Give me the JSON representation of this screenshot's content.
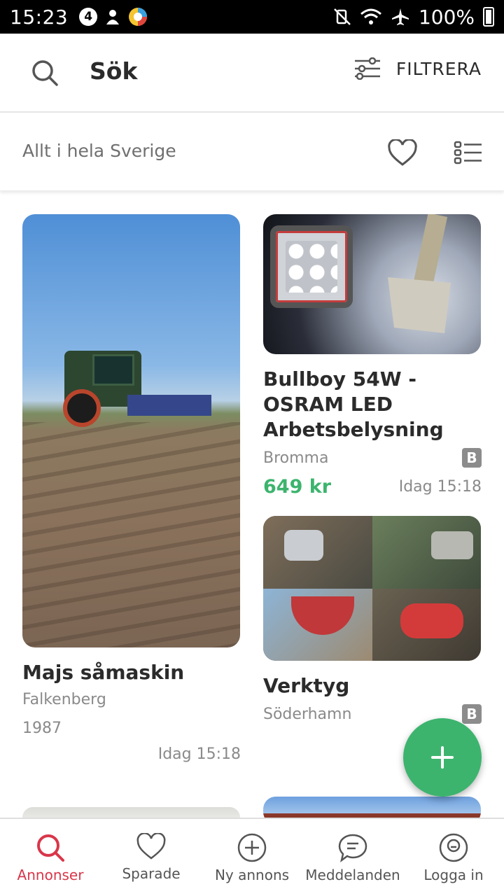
{
  "status_bar": {
    "time": "15:23",
    "notification_badge": "4",
    "battery": "100%"
  },
  "header": {
    "title": "Sök",
    "filter_label": "FILTRERA"
  },
  "subbar": {
    "location": "Allt i hela Sverige"
  },
  "listings": [
    {
      "title": "Majs såmaskin",
      "location": "Falkenberg",
      "extra": "1987",
      "time": "Idag 15:18"
    },
    {
      "title": "Bullboy 54W - OSRAM LED Arbetsbelysning",
      "location": "Bromma",
      "badge": "B",
      "price": "649 kr",
      "time": "Idag 15:18"
    },
    {
      "title": "Verktyg",
      "location": "Söderhamn",
      "badge": "B"
    }
  ],
  "nav": [
    {
      "label": "Annonser",
      "active": true
    },
    {
      "label": "Sparade"
    },
    {
      "label": "Ny annons"
    },
    {
      "label": "Meddelanden"
    },
    {
      "label": "Logga in"
    }
  ],
  "colors": {
    "accent_green": "#3cb46e",
    "active_red": "#d9364a",
    "badge_grey": "#8c8c8c"
  }
}
